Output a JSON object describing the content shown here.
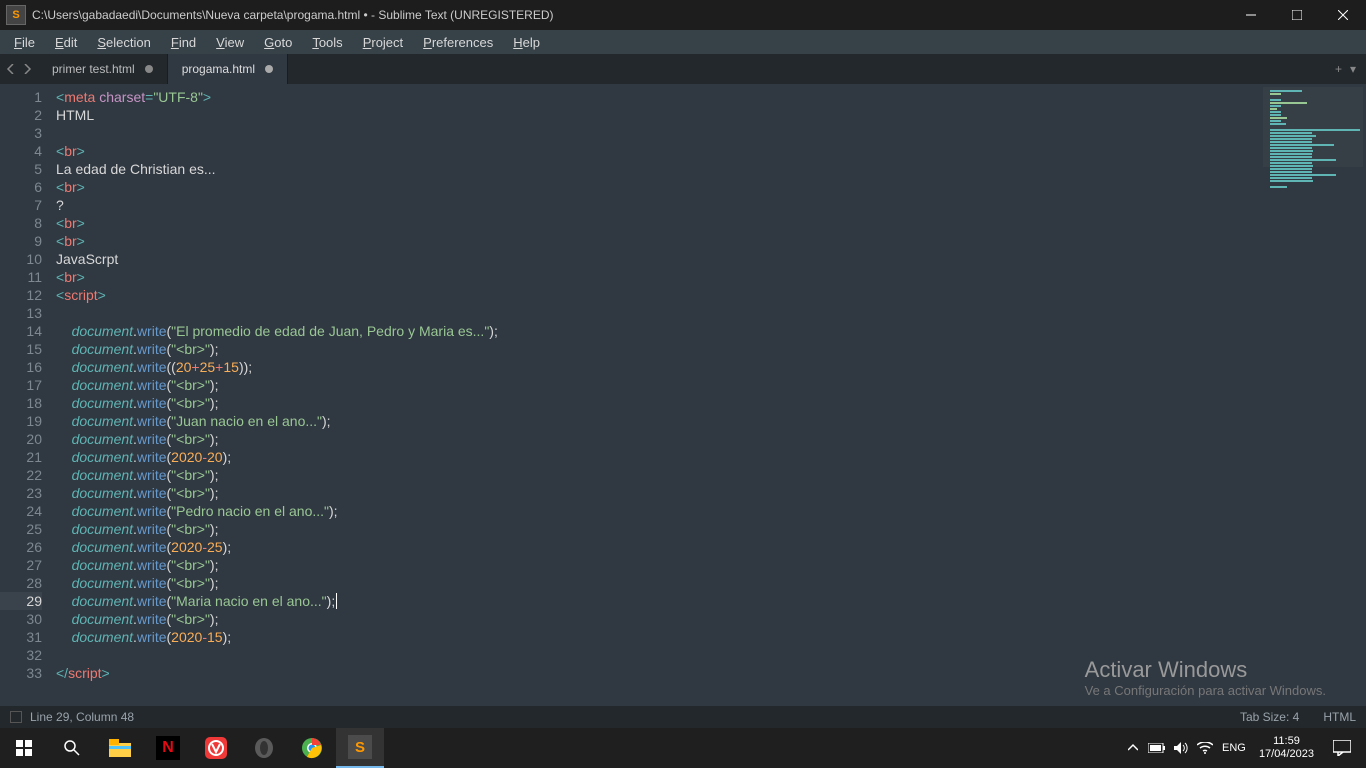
{
  "titlebar": {
    "appicon_letter": "S",
    "path": "C:\\Users\\gabadaedi\\Documents\\Nueva carpeta\\progama.html • - Sublime Text (UNREGISTERED)"
  },
  "menus": [
    "File",
    "Edit",
    "Selection",
    "Find",
    "View",
    "Goto",
    "Tools",
    "Project",
    "Preferences",
    "Help"
  ],
  "tabs": {
    "items": [
      {
        "label": "primer test.html",
        "active": false,
        "dirty": true
      },
      {
        "label": "progama.html",
        "active": true,
        "dirty": true
      }
    ],
    "newtab": "▾",
    "plus": "+"
  },
  "code": {
    "lines": [
      {
        "n": 1,
        "segs": [
          {
            "t": "<",
            "c": "pun"
          },
          {
            "t": "meta",
            "c": "tag"
          },
          {
            "t": " ",
            "c": "plain"
          },
          {
            "t": "charset",
            "c": "attr"
          },
          {
            "t": "=",
            "c": "pun"
          },
          {
            "t": "\"UTF-8\"",
            "c": "str"
          },
          {
            "t": ">",
            "c": "pun"
          }
        ]
      },
      {
        "n": 2,
        "segs": [
          {
            "t": "HTML",
            "c": "plain"
          }
        ]
      },
      {
        "n": 3,
        "segs": []
      },
      {
        "n": 4,
        "segs": [
          {
            "t": "<",
            "c": "pun"
          },
          {
            "t": "br",
            "c": "tag"
          },
          {
            "t": ">",
            "c": "pun"
          }
        ]
      },
      {
        "n": 5,
        "segs": [
          {
            "t": "La edad de Christian es...",
            "c": "plain"
          }
        ]
      },
      {
        "n": 6,
        "segs": [
          {
            "t": "<",
            "c": "pun"
          },
          {
            "t": "br",
            "c": "tag"
          },
          {
            "t": ">",
            "c": "pun"
          }
        ]
      },
      {
        "n": 7,
        "segs": [
          {
            "t": "?",
            "c": "plain"
          }
        ]
      },
      {
        "n": 8,
        "segs": [
          {
            "t": "<",
            "c": "pun"
          },
          {
            "t": "br",
            "c": "tag"
          },
          {
            "t": ">",
            "c": "pun"
          }
        ]
      },
      {
        "n": 9,
        "segs": [
          {
            "t": "<",
            "c": "pun"
          },
          {
            "t": "br",
            "c": "tag"
          },
          {
            "t": ">",
            "c": "pun"
          }
        ]
      },
      {
        "n": 10,
        "segs": [
          {
            "t": "JavaScrpt",
            "c": "plain"
          }
        ]
      },
      {
        "n": 11,
        "segs": [
          {
            "t": "<",
            "c": "pun"
          },
          {
            "t": "br",
            "c": "tag"
          },
          {
            "t": ">",
            "c": "pun"
          }
        ]
      },
      {
        "n": 12,
        "segs": [
          {
            "t": "<",
            "c": "pun"
          },
          {
            "t": "script",
            "c": "tag"
          },
          {
            "t": ">",
            "c": "pun"
          }
        ]
      },
      {
        "n": 13,
        "segs": []
      },
      {
        "n": 14,
        "indent": 1,
        "segs": [
          {
            "t": "document",
            "c": "ital"
          },
          {
            "t": ".",
            "c": "plain"
          },
          {
            "t": "write",
            "c": "method"
          },
          {
            "t": "(",
            "c": "plain"
          },
          {
            "t": "\"El promedio de edad de Juan, Pedro y Maria es...\"",
            "c": "str"
          },
          {
            "t": ");",
            "c": "plain"
          }
        ]
      },
      {
        "n": 15,
        "indent": 1,
        "segs": [
          {
            "t": "document",
            "c": "ital"
          },
          {
            "t": ".",
            "c": "plain"
          },
          {
            "t": "write",
            "c": "method"
          },
          {
            "t": "(",
            "c": "plain"
          },
          {
            "t": "\"<br>\"",
            "c": "str"
          },
          {
            "t": ");",
            "c": "plain"
          }
        ]
      },
      {
        "n": 16,
        "indent": 1,
        "segs": [
          {
            "t": "document",
            "c": "ital"
          },
          {
            "t": ".",
            "c": "plain"
          },
          {
            "t": "write",
            "c": "method"
          },
          {
            "t": "((",
            "c": "plain"
          },
          {
            "t": "20",
            "c": "num"
          },
          {
            "t": "+",
            "c": "op"
          },
          {
            "t": "25",
            "c": "num"
          },
          {
            "t": "+",
            "c": "op"
          },
          {
            "t": "15",
            "c": "num"
          },
          {
            "t": "));",
            "c": "plain"
          }
        ]
      },
      {
        "n": 17,
        "indent": 1,
        "segs": [
          {
            "t": "document",
            "c": "ital"
          },
          {
            "t": ".",
            "c": "plain"
          },
          {
            "t": "write",
            "c": "method"
          },
          {
            "t": "(",
            "c": "plain"
          },
          {
            "t": "\"<br>\"",
            "c": "str"
          },
          {
            "t": ");",
            "c": "plain"
          }
        ]
      },
      {
        "n": 18,
        "indent": 1,
        "segs": [
          {
            "t": "document",
            "c": "ital"
          },
          {
            "t": ".",
            "c": "plain"
          },
          {
            "t": "write",
            "c": "method"
          },
          {
            "t": "(",
            "c": "plain"
          },
          {
            "t": "\"<br>\"",
            "c": "str"
          },
          {
            "t": ");",
            "c": "plain"
          }
        ]
      },
      {
        "n": 19,
        "indent": 1,
        "segs": [
          {
            "t": "document",
            "c": "ital"
          },
          {
            "t": ".",
            "c": "plain"
          },
          {
            "t": "write",
            "c": "method"
          },
          {
            "t": "(",
            "c": "plain"
          },
          {
            "t": "\"Juan nacio en el ano...\"",
            "c": "str"
          },
          {
            "t": ");",
            "c": "plain"
          }
        ]
      },
      {
        "n": 20,
        "indent": 1,
        "segs": [
          {
            "t": "document",
            "c": "ital"
          },
          {
            "t": ".",
            "c": "plain"
          },
          {
            "t": "write",
            "c": "method"
          },
          {
            "t": "(",
            "c": "plain"
          },
          {
            "t": "\"<br>\"",
            "c": "str"
          },
          {
            "t": ");",
            "c": "plain"
          }
        ]
      },
      {
        "n": 21,
        "indent": 1,
        "segs": [
          {
            "t": "document",
            "c": "ital"
          },
          {
            "t": ".",
            "c": "plain"
          },
          {
            "t": "write",
            "c": "method"
          },
          {
            "t": "(",
            "c": "plain"
          },
          {
            "t": "2020",
            "c": "num"
          },
          {
            "t": "-",
            "c": "op"
          },
          {
            "t": "20",
            "c": "num"
          },
          {
            "t": ");",
            "c": "plain"
          }
        ]
      },
      {
        "n": 22,
        "indent": 1,
        "segs": [
          {
            "t": "document",
            "c": "ital"
          },
          {
            "t": ".",
            "c": "plain"
          },
          {
            "t": "write",
            "c": "method"
          },
          {
            "t": "(",
            "c": "plain"
          },
          {
            "t": "\"<br>\"",
            "c": "str"
          },
          {
            "t": ");",
            "c": "plain"
          }
        ]
      },
      {
        "n": 23,
        "indent": 1,
        "segs": [
          {
            "t": "document",
            "c": "ital"
          },
          {
            "t": ".",
            "c": "plain"
          },
          {
            "t": "write",
            "c": "method"
          },
          {
            "t": "(",
            "c": "plain"
          },
          {
            "t": "\"<br>\"",
            "c": "str"
          },
          {
            "t": ");",
            "c": "plain"
          }
        ]
      },
      {
        "n": 24,
        "indent": 1,
        "segs": [
          {
            "t": "document",
            "c": "ital"
          },
          {
            "t": ".",
            "c": "plain"
          },
          {
            "t": "write",
            "c": "method"
          },
          {
            "t": "(",
            "c": "plain"
          },
          {
            "t": "\"Pedro nacio en el ano...\"",
            "c": "str"
          },
          {
            "t": ");",
            "c": "plain"
          }
        ]
      },
      {
        "n": 25,
        "indent": 1,
        "segs": [
          {
            "t": "document",
            "c": "ital"
          },
          {
            "t": ".",
            "c": "plain"
          },
          {
            "t": "write",
            "c": "method"
          },
          {
            "t": "(",
            "c": "plain"
          },
          {
            "t": "\"<br>\"",
            "c": "str"
          },
          {
            "t": ");",
            "c": "plain"
          }
        ]
      },
      {
        "n": 26,
        "indent": 1,
        "segs": [
          {
            "t": "document",
            "c": "ital"
          },
          {
            "t": ".",
            "c": "plain"
          },
          {
            "t": "write",
            "c": "method"
          },
          {
            "t": "(",
            "c": "plain"
          },
          {
            "t": "2020",
            "c": "num"
          },
          {
            "t": "-",
            "c": "op"
          },
          {
            "t": "25",
            "c": "num"
          },
          {
            "t": ");",
            "c": "plain"
          }
        ]
      },
      {
        "n": 27,
        "indent": 1,
        "segs": [
          {
            "t": "document",
            "c": "ital"
          },
          {
            "t": ".",
            "c": "plain"
          },
          {
            "t": "write",
            "c": "method"
          },
          {
            "t": "(",
            "c": "plain"
          },
          {
            "t": "\"<br>\"",
            "c": "str"
          },
          {
            "t": ");",
            "c": "plain"
          }
        ]
      },
      {
        "n": 28,
        "indent": 1,
        "segs": [
          {
            "t": "document",
            "c": "ital"
          },
          {
            "t": ".",
            "c": "plain"
          },
          {
            "t": "write",
            "c": "method"
          },
          {
            "t": "(",
            "c": "plain"
          },
          {
            "t": "\"<br>\"",
            "c": "str"
          },
          {
            "t": ");",
            "c": "plain"
          }
        ]
      },
      {
        "n": 29,
        "indent": 1,
        "hl": true,
        "cursor": true,
        "segs": [
          {
            "t": "document",
            "c": "ital"
          },
          {
            "t": ".",
            "c": "plain"
          },
          {
            "t": "write",
            "c": "method"
          },
          {
            "t": "(",
            "c": "plain"
          },
          {
            "t": "\"Maria nacio en el ano...\"",
            "c": "str"
          },
          {
            "t": ");",
            "c": "plain"
          }
        ]
      },
      {
        "n": 30,
        "indent": 1,
        "segs": [
          {
            "t": "document",
            "c": "ital"
          },
          {
            "t": ".",
            "c": "plain"
          },
          {
            "t": "write",
            "c": "method"
          },
          {
            "t": "(",
            "c": "plain"
          },
          {
            "t": "\"<br>\"",
            "c": "str"
          },
          {
            "t": ");",
            "c": "plain"
          }
        ]
      },
      {
        "n": 31,
        "indent": 1,
        "segs": [
          {
            "t": "document",
            "c": "ital"
          },
          {
            "t": ".",
            "c": "plain"
          },
          {
            "t": "write",
            "c": "method"
          },
          {
            "t": "(",
            "c": "plain"
          },
          {
            "t": "2020",
            "c": "num"
          },
          {
            "t": "-",
            "c": "op"
          },
          {
            "t": "15",
            "c": "num"
          },
          {
            "t": ");",
            "c": "plain"
          }
        ]
      },
      {
        "n": 32,
        "segs": []
      },
      {
        "n": 33,
        "segs": [
          {
            "t": "</",
            "c": "pun"
          },
          {
            "t": "script",
            "c": "tag"
          },
          {
            "t": ">",
            "c": "pun"
          }
        ]
      }
    ]
  },
  "watermark": {
    "big": "Activar Windows",
    "small": "Ve a Configuración para activar Windows."
  },
  "status": {
    "pos": "Line 29, Column 48",
    "tabsize": "Tab Size: 4",
    "syntax": "HTML"
  },
  "taskbar": {
    "lang": "ENG",
    "time": "11:59",
    "date": "17/04/2023"
  }
}
